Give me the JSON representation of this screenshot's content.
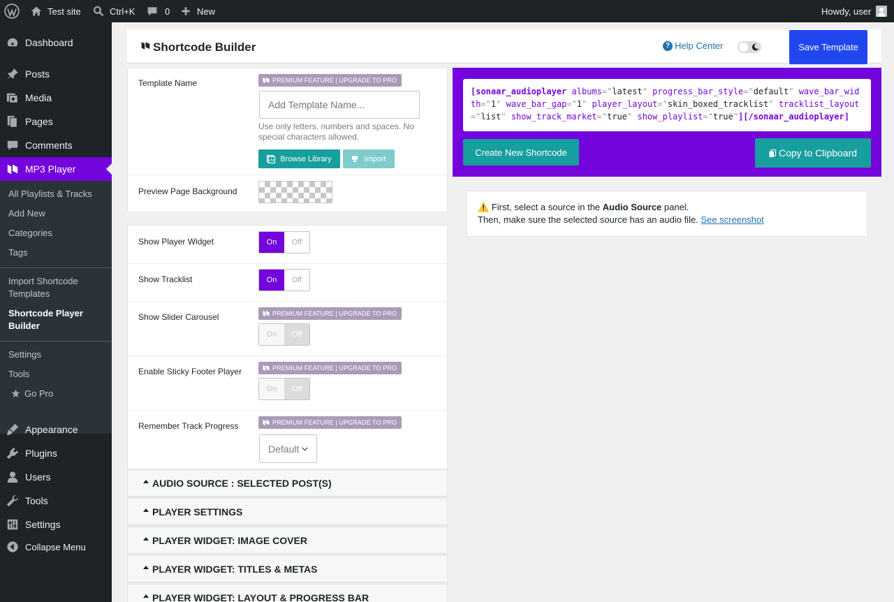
{
  "adminbar": {
    "site_name": "Test site",
    "search_shortcut": "Ctrl+K",
    "comments_count": "0",
    "new_label": "New",
    "howdy": "Howdy, user"
  },
  "sidebar": {
    "items": [
      {
        "label": "Dashboard",
        "icon": "dashboard-icon"
      },
      {
        "label": "Posts",
        "icon": "pin-icon"
      },
      {
        "label": "Media",
        "icon": "media-icon"
      },
      {
        "label": "Pages",
        "icon": "pages-icon"
      },
      {
        "label": "Comments",
        "icon": "comment-icon"
      },
      {
        "label": "MP3 Player",
        "icon": "mp3-player-icon"
      },
      {
        "label": "Appearance",
        "icon": "brush-icon"
      },
      {
        "label": "Plugins",
        "icon": "plugin-icon"
      },
      {
        "label": "Users",
        "icon": "user-icon"
      },
      {
        "label": "Tools",
        "icon": "wrench-icon"
      },
      {
        "label": "Settings",
        "icon": "sliders-icon"
      },
      {
        "label": "Collapse Menu",
        "icon": "collapse-icon"
      }
    ],
    "submenu": [
      "All Playlists & Tracks",
      "Add New",
      "Categories",
      "Tags",
      "Import Shortcode Templates",
      "Shortcode Player Builder",
      "Settings",
      "Tools",
      "Go Pro"
    ]
  },
  "header": {
    "title": "Shortcode Builder",
    "help_label": "Help Center",
    "save_label": "Save Template"
  },
  "template": {
    "name_label": "Template Name",
    "premium_badge": "PREMIUM FEATURE | UPGRADE TO PRO",
    "name_placeholder": "Add Template Name...",
    "name_hint": "Use only letters, numbers and spaces. No special characters allowed.",
    "browse_label": "Browse Library",
    "import_label": "Import",
    "bg_label": "Preview Page Background"
  },
  "options": {
    "on": "On",
    "off": "Off",
    "rows": [
      {
        "label": "Show Player Widget",
        "state": "On",
        "premium": false
      },
      {
        "label": "Show Tracklist",
        "state": "On",
        "premium": false
      },
      {
        "label": "Show Slider Carousel",
        "state": "Off",
        "premium": true
      },
      {
        "label": "Enable Sticky Footer Player",
        "state": "Off",
        "premium": true
      }
    ],
    "remember_label": "Remember Track Progress",
    "remember_value": "Default"
  },
  "accordions": [
    "AUDIO SOURCE : SELECTED POST(S)",
    "PLAYER SETTINGS",
    "PLAYER WIDGET: IMAGE COVER",
    "PLAYER WIDGET: TITLES & METAS",
    "PLAYER WIDGET: LAYOUT & PROGRESS BAR"
  ],
  "shortcode": {
    "tag_open": "[sonaar_audioplayer",
    "attrs": [
      {
        "name": "albums",
        "value": "latest"
      },
      {
        "name": "progress_bar_style",
        "value": "default"
      },
      {
        "name": "wave_bar_width",
        "value": "1"
      },
      {
        "name": "wave_bar_gap",
        "value": "1"
      },
      {
        "name": "player_layout",
        "value": "skin_boxed_tracklist"
      },
      {
        "name": "tracklist_layout",
        "value": "list"
      },
      {
        "name": "show_track_market",
        "value": "true"
      },
      {
        "name": "show_playlist",
        "value": "true"
      }
    ],
    "tag_close": "][/sonaar_audioplayer]",
    "create_label": "Create New Shortcode",
    "copy_label": "Copy to Clipboard"
  },
  "notice": {
    "warn_glyph": "⚠️",
    "line1_pre": "First, select a source in the",
    "line1_bold": "Audio Source",
    "line1_post": "panel.",
    "line2": "Then, make sure the selected source has an audio file.",
    "link": "See screenshot"
  }
}
